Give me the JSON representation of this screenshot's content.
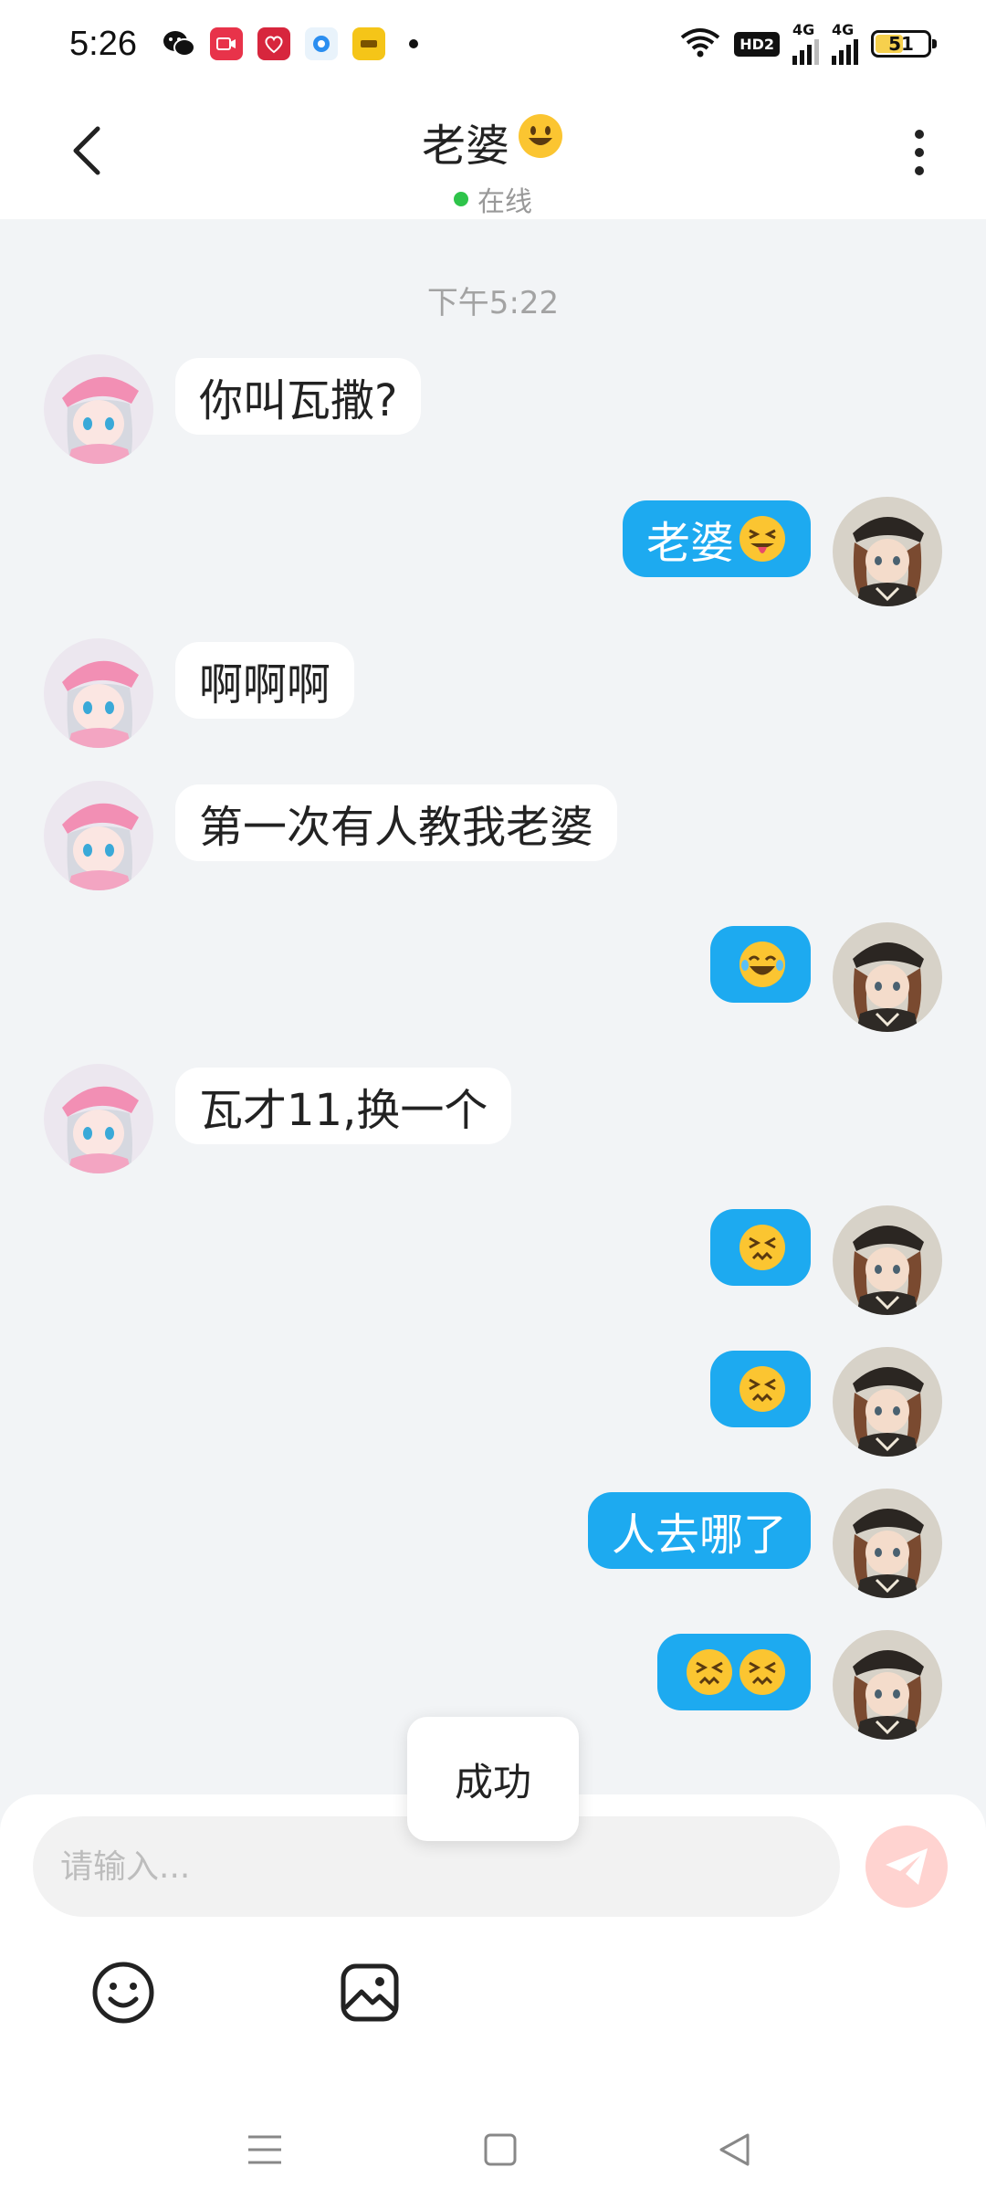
{
  "status_bar": {
    "time": "5:26",
    "notifications": [
      "wechat-icon",
      "video-app-icon",
      "gift-app-icon",
      "browser-icon",
      "gold-app-icon"
    ],
    "network_1": "4G",
    "network_2": "4G",
    "hd_label": "HD2",
    "battery": "51",
    "battery_level": 0.51
  },
  "header": {
    "title": "老婆",
    "title_emoji": "smiley-emoji",
    "status": "在线"
  },
  "chat": {
    "timestamp": "下午5:22",
    "messages": [
      {
        "side": "left",
        "text": "你叫瓦撒?"
      },
      {
        "side": "right",
        "text": "老婆",
        "emoji": "tongue-out-emoji"
      },
      {
        "side": "left",
        "text": "啊啊啊"
      },
      {
        "side": "left",
        "text": "第一次有人教我老婆"
      },
      {
        "side": "right",
        "text": "",
        "emoji": "laughing-tears-emoji"
      },
      {
        "side": "left",
        "text": "瓦才11,换一个"
      },
      {
        "side": "right",
        "text": "",
        "emoji": "confounded-emoji"
      },
      {
        "side": "right",
        "text": "",
        "emoji": "confounded-emoji"
      },
      {
        "side": "right",
        "text": "人去哪了"
      },
      {
        "side": "right",
        "text": "",
        "emoji": "double-confounded-emoji"
      }
    ]
  },
  "toast": {
    "text": "成功"
  },
  "input": {
    "placeholder": "请输入..."
  },
  "colors": {
    "accent_blue": "#1daaf0",
    "online_green": "#2ec44a",
    "send_disabled": "#ffd3d0",
    "background": "#f2f4f6"
  }
}
